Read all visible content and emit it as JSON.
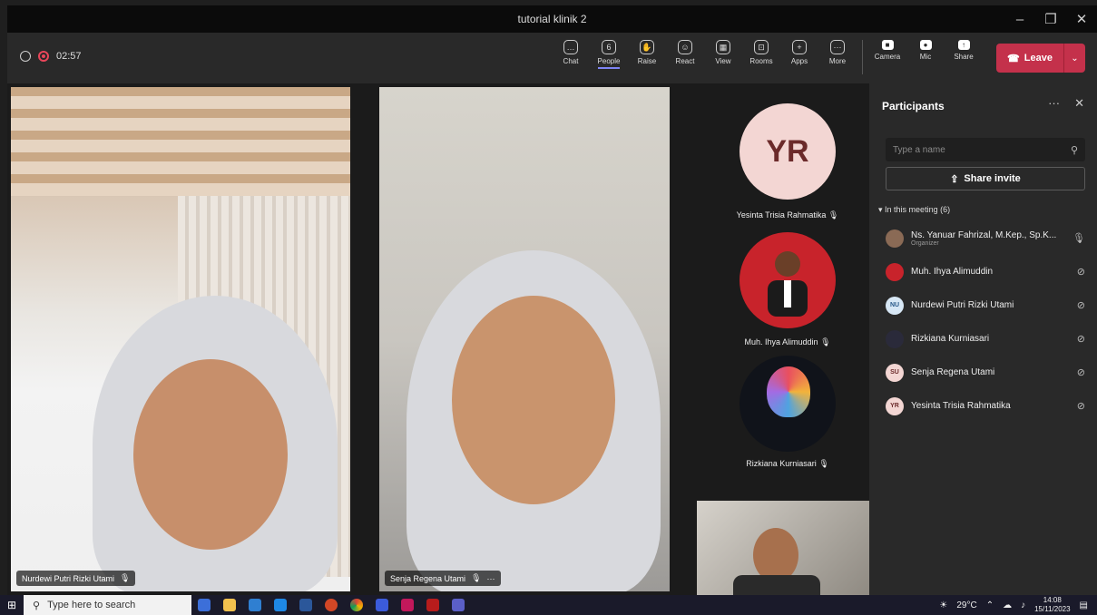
{
  "window": {
    "title": "tutorial klinik 2",
    "controls": [
      "–",
      "❐",
      "✕"
    ]
  },
  "toolbar": {
    "timer": "02:57",
    "items": [
      {
        "id": "chat",
        "label": "Chat",
        "icon": "chat-icon",
        "glyph": "…"
      },
      {
        "id": "people",
        "label": "People",
        "icon": "people-icon",
        "glyph": "6",
        "active": true
      },
      {
        "id": "raise",
        "label": "Raise",
        "icon": "hand-icon",
        "glyph": "✋"
      },
      {
        "id": "react",
        "label": "React",
        "icon": "smile-icon",
        "glyph": "☺"
      },
      {
        "id": "view",
        "label": "View",
        "icon": "view-icon",
        "glyph": "▦"
      },
      {
        "id": "rooms",
        "label": "Rooms",
        "icon": "rooms-icon",
        "glyph": "⊡"
      },
      {
        "id": "apps",
        "label": "Apps",
        "icon": "apps-icon",
        "glyph": "+"
      },
      {
        "id": "more",
        "label": "More",
        "icon": "more-icon",
        "glyph": "···"
      }
    ],
    "devices": [
      {
        "id": "camera",
        "label": "Camera",
        "icon": "camera-icon",
        "glyph": "■"
      },
      {
        "id": "mic",
        "label": "Mic",
        "icon": "mic-icon",
        "glyph": "●"
      },
      {
        "id": "share",
        "label": "Share",
        "icon": "share-icon",
        "glyph": "↑"
      }
    ],
    "leave_label": "Leave",
    "leave_color": "#c4314b"
  },
  "stage": {
    "tile1_name": "Nurdewi Putri Rizki Utami",
    "tile2_name": "Senja Regena Utami",
    "avatar1": {
      "initials": "YR",
      "name": "Yesinta Trisia Rahmatika"
    },
    "avatar2": {
      "name": "Muh. Ihya Alimuddin"
    },
    "avatar3": {
      "name": "Rizkiana Kurniasari"
    }
  },
  "panel": {
    "title": "Participants",
    "search_placeholder": "Type a name",
    "share_label": "Share invite",
    "section": "In this meeting (6)",
    "participants": [
      {
        "name": "Ns. Yanuar Fahrizal, M.Kep., Sp.K...",
        "sub": "Organizer",
        "initials": "",
        "color": "#8a6a55"
      },
      {
        "name": "Muh. Ihya Alimuddin",
        "sub": "",
        "initials": "",
        "color": "#c8232b"
      },
      {
        "name": "Nurdewi Putri Rizki Utami",
        "sub": "",
        "initials": "NU",
        "color": "#d7e7f5"
      },
      {
        "name": "Rizkiana Kurniasari",
        "sub": "",
        "initials": "",
        "color": "#2a2a3a"
      },
      {
        "name": "Senja Regena Utami",
        "sub": "",
        "initials": "SU",
        "color": "#f3d6d3"
      },
      {
        "name": "Yesinta Trisia Rahmatika",
        "sub": "",
        "initials": "YR",
        "color": "#f3d6d3"
      }
    ]
  },
  "taskbar": {
    "search_placeholder": "Type here to search",
    "weather": "29°C",
    "time": "14:08",
    "date": "15/11/2023"
  }
}
